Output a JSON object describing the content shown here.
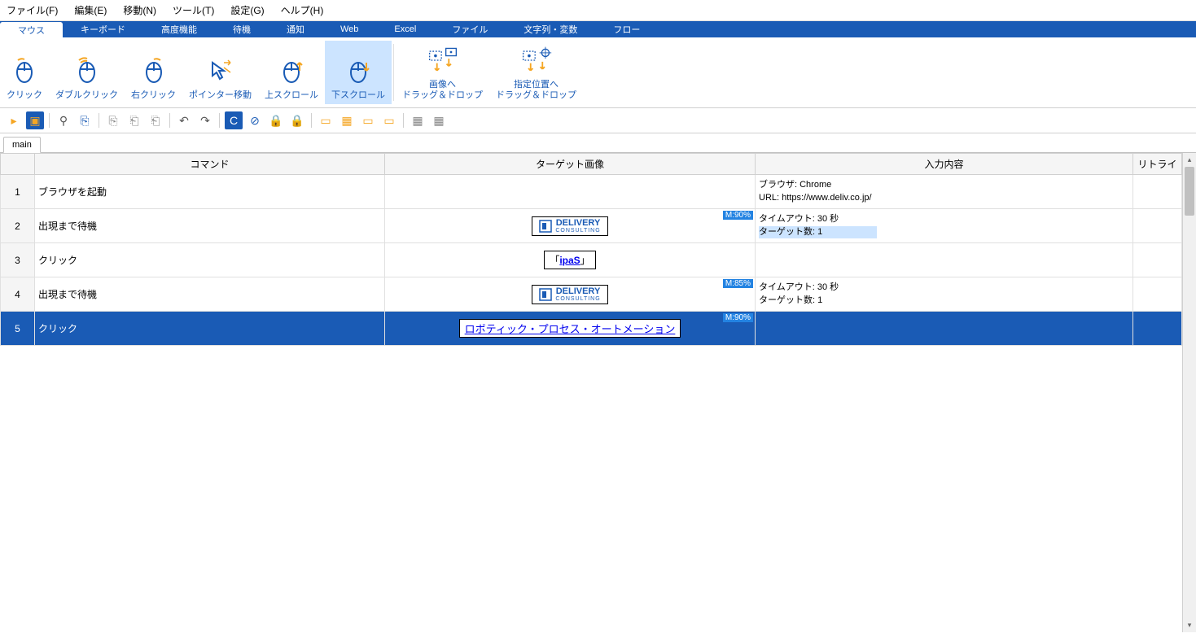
{
  "menubar": [
    "ファイル(F)",
    "編集(E)",
    "移動(N)",
    "ツール(T)",
    "設定(G)",
    "ヘルプ(H)"
  ],
  "tabs": [
    "マウス",
    "キーボード",
    "高度機能",
    "待機",
    "通知",
    "Web",
    "Excel",
    "ファイル",
    "文字列・変数",
    "フロー"
  ],
  "active_tab": 0,
  "ribbon": [
    {
      "label": "クリック",
      "icon": "click"
    },
    {
      "label": "ダブルクリック",
      "icon": "dblclick"
    },
    {
      "label": "右クリック",
      "icon": "rclick"
    },
    {
      "label": "ポインター移動",
      "icon": "move"
    },
    {
      "label": "上スクロール",
      "icon": "scrollup"
    },
    {
      "label": "下スクロール",
      "icon": "scrolldown",
      "active": true
    },
    {
      "label": "画像へ\nドラッグ＆ドロップ",
      "icon": "dragimg"
    },
    {
      "label": "指定位置へ\nドラッグ＆ドロップ",
      "icon": "dragpos"
    }
  ],
  "doc_tab": "main",
  "headers": {
    "cmd": "コマンド",
    "img": "ターゲット画像",
    "input": "入力内容",
    "retry": "リトライ"
  },
  "rows": [
    {
      "n": 1,
      "cmd": "ブラウザを起動",
      "img": null,
      "badge": null,
      "input": [
        "ブラウザ: Chrome",
        "URL: https://www.deliv.co.jp/"
      ]
    },
    {
      "n": 2,
      "cmd": "出現まで待機",
      "img": "delivery",
      "badge": "M:90%",
      "input": [
        "タイムアウト: 30 秒",
        "ターゲット数: 1"
      ],
      "input_hl": true
    },
    {
      "n": 3,
      "cmd": "クリック",
      "img": "ipas",
      "badge": null,
      "input": []
    },
    {
      "n": 4,
      "cmd": "出現まで待機",
      "img": "delivery",
      "badge": "M:85%",
      "input": [
        "タイムアウト: 30 秒",
        "ターゲット数: 1"
      ]
    },
    {
      "n": 5,
      "cmd": "クリック",
      "img": "rpa",
      "badge": "M:90%",
      "input": [],
      "selected": true
    }
  ],
  "thumbs": {
    "delivery_main": "DELIVERY",
    "delivery_sub": "CONSULTING",
    "ipas_text": "「ipaS」",
    "rpa_text": "ロボティック・プロセス・オートメーション"
  }
}
